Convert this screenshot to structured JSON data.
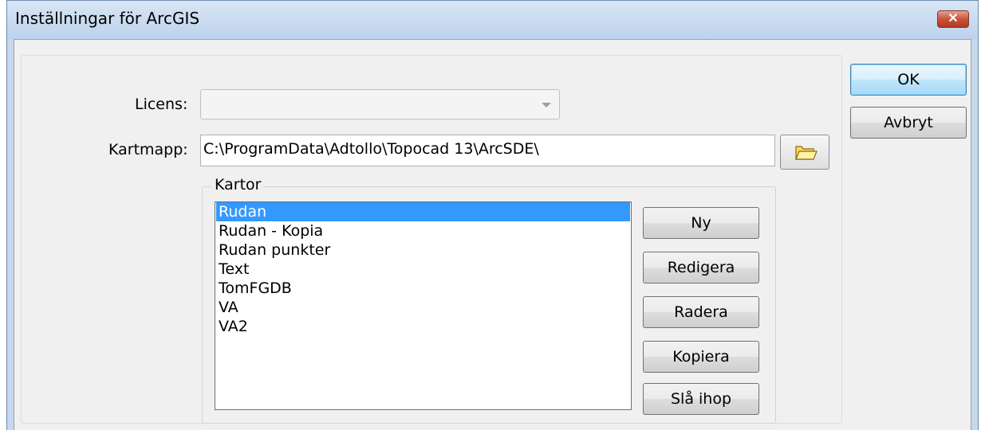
{
  "window": {
    "title": "Inställningar för ArcGIS"
  },
  "form": {
    "license_label": "Licens:",
    "license_value": "",
    "mapfolder_label": "Kartmapp:",
    "mapfolder_value": "C:\\ProgramData\\Adtollo\\Topocad 13\\ArcSDE\\"
  },
  "maps_group": {
    "label": "Kartor",
    "items": [
      "Rudan",
      "Rudan - Kopia",
      "Rudan punkter",
      "Text",
      "TomFGDB",
      "VA",
      "VA2"
    ],
    "selected_index": 0
  },
  "map_buttons": {
    "new": "Ny",
    "edit": "Redigera",
    "delete": "Radera",
    "copy": "Kopiera",
    "merge": "Slå ihop"
  },
  "dialog_buttons": {
    "ok": "OK",
    "cancel": "Avbryt"
  },
  "icons": {
    "close": "close-icon",
    "browse": "folder-icon",
    "dropdown": "chevron-down-icon"
  },
  "colors": {
    "selection": "#3399ff",
    "close_button": "#c9533a",
    "titlebar": "#c5d8ee"
  }
}
